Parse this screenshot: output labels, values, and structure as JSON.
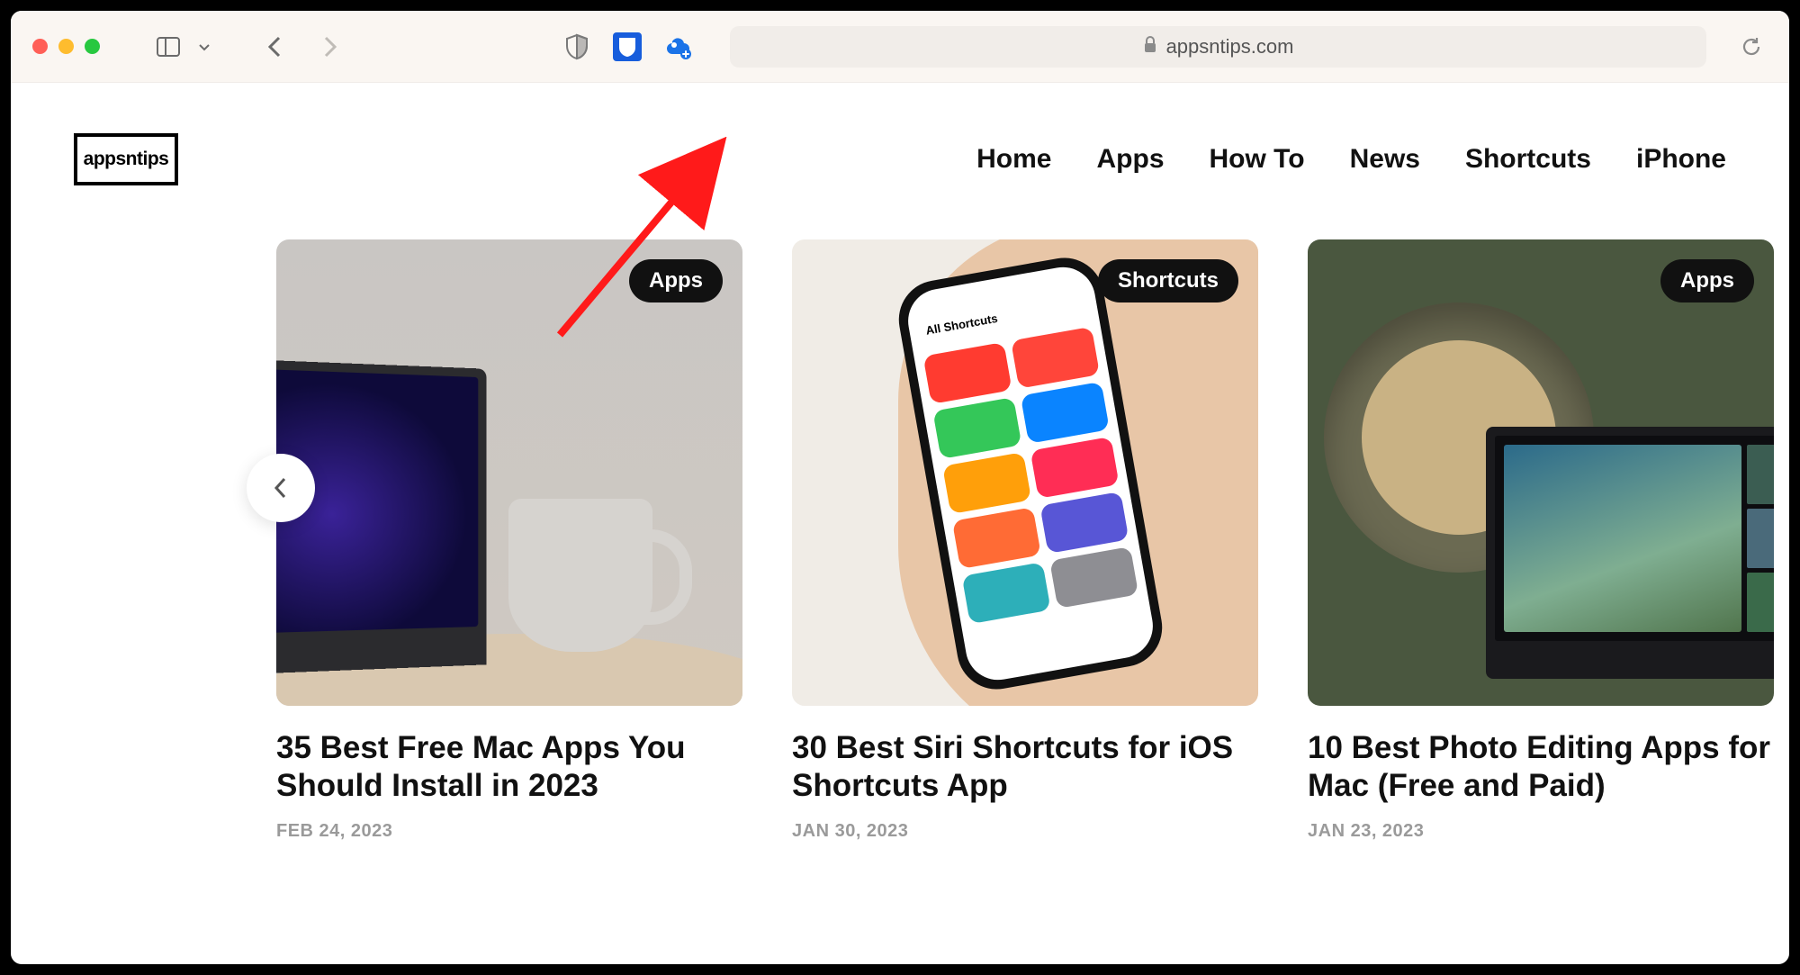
{
  "browser": {
    "url": "appsntips.com"
  },
  "site": {
    "logo_text": "appsntips",
    "nav": [
      "Home",
      "Apps",
      "How To",
      "News",
      "Shortcuts",
      "iPhone"
    ]
  },
  "cards": [
    {
      "badge": "Apps",
      "title": "35 Best Free Mac Apps You Should Install in 2023",
      "date": "FEB 24, 2023"
    },
    {
      "badge": "Shortcuts",
      "title": "30 Best Siri Shortcuts for iOS Shortcuts App",
      "date": "JAN 30, 2023",
      "phone_header": "All Shortcuts"
    },
    {
      "badge": "Apps",
      "title": "10 Best Photo Editing Apps for Mac (Free and Paid)",
      "date": "JAN 23, 2023"
    }
  ]
}
